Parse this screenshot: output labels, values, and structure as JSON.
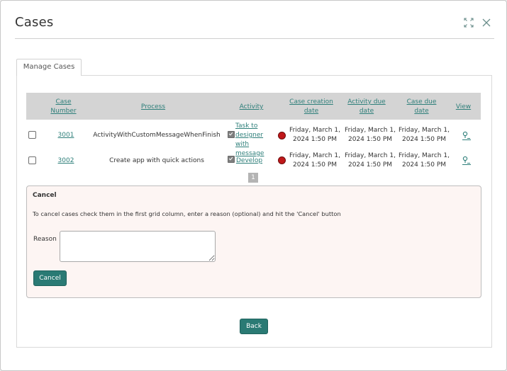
{
  "dialog": {
    "title": "Cases"
  },
  "tabs": [
    {
      "label": "Manage Cases"
    }
  ],
  "grid": {
    "headers": {
      "case_number": "Case Number",
      "process": "Process",
      "activity": "Activity",
      "case_creation_date": "Case creation date",
      "activity_due_date": "Activity due date",
      "case_due_date": "Case due date",
      "view": "View"
    },
    "rows": [
      {
        "case_number": "3001",
        "process": "ActivityWithCustomMessageWhenFinish",
        "activity": "Task to designer with message",
        "case_creation_date": "Friday, March 1, 2024 1:50 PM",
        "activity_due_date": "Friday, March 1, 2024 1:50 PM",
        "case_due_date": "Friday, March 1, 2024 1:50 PM"
      },
      {
        "case_number": "3002",
        "process": "Create app with quick actions",
        "activity": "Develop",
        "case_creation_date": "Friday, March 1, 2024 1:50 PM",
        "activity_due_date": "Friday, March 1, 2024 1:50 PM",
        "case_due_date": "Friday, March 1, 2024 1:50 PM"
      }
    ],
    "pager": {
      "current_page": "1"
    }
  },
  "cancel_section": {
    "title": "Cancel",
    "instructions": "To cancel cases check them in the first grid column, enter a reason (optional) and hit the 'Cancel' button",
    "reason_label": "Reason",
    "reason_value": "",
    "cancel_button": "Cancel"
  },
  "footer": {
    "back_button": "Back"
  },
  "colors": {
    "accent": "#2a7a74",
    "link": "#2e7f7a",
    "status_overdue": "#c0181a",
    "grid_header_bg": "#d4d4d4",
    "cancel_panel_bg": "#fdf5f3"
  },
  "icons": {
    "maximize": "expand-icon",
    "close": "close-icon",
    "activity": "checkbox-check-icon",
    "status": "status-red-dot-icon",
    "view": "view-map-pin-icon"
  }
}
